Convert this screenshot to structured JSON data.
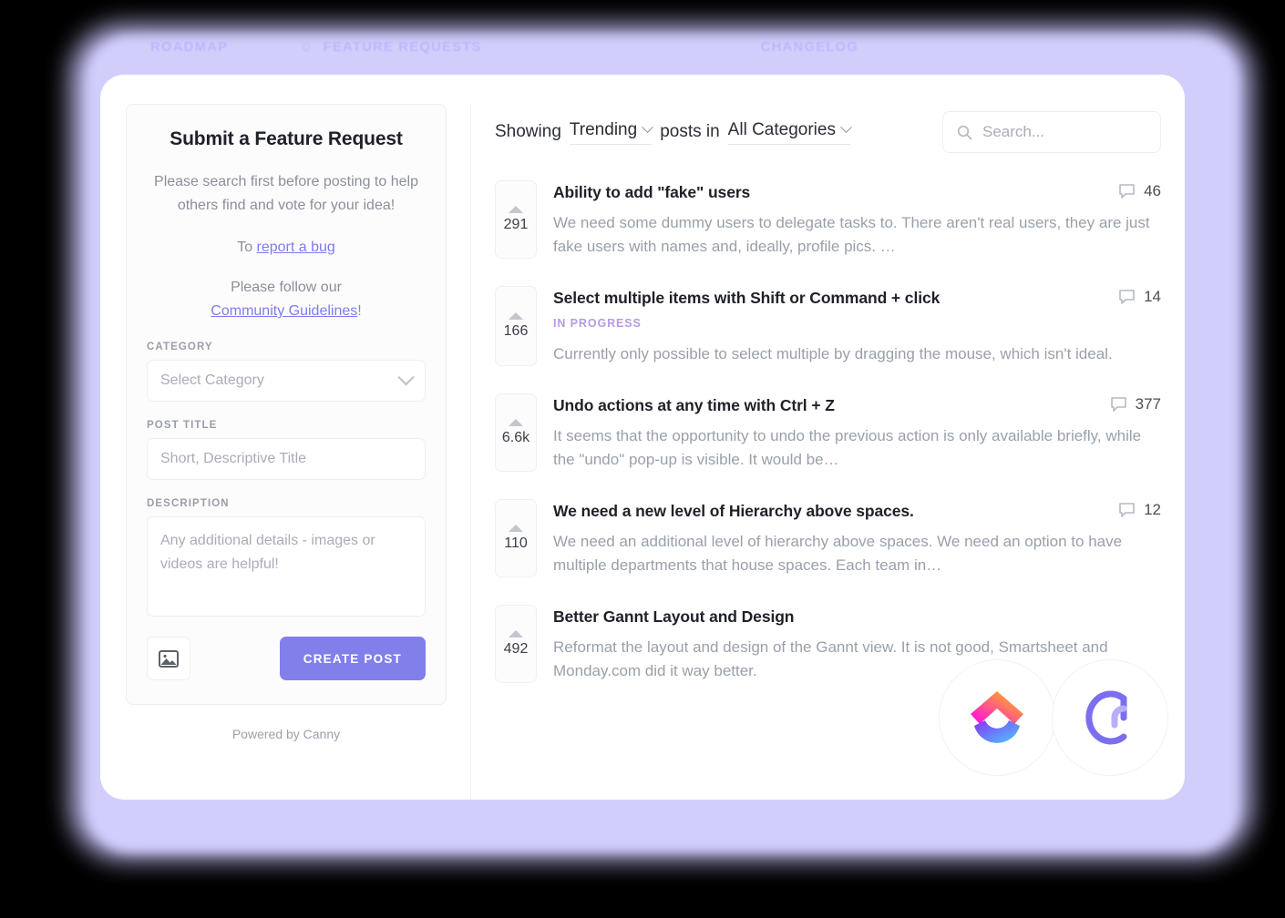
{
  "nav": {
    "items": [
      {
        "label": "ROADMAP"
      },
      {
        "label": "FEATURE REQUESTS"
      },
      {
        "label": "CHANGELOG"
      }
    ]
  },
  "form": {
    "title": "Submit a Feature Request",
    "blurb_1": "Please search first before posting to help others find and vote for your idea!",
    "blurb_2_prefix": "To ",
    "blurb_2_link": "report a bug",
    "blurb_3_prefix": "Please follow our",
    "blurb_3_link": "Community Guidelines",
    "blurb_3_suffix": "!",
    "category_label": "CATEGORY",
    "category_value": "Select Category",
    "post_title_label": "POST TITLE",
    "post_title_placeholder": "Short, Descriptive Title",
    "description_label": "DESCRIPTION",
    "description_placeholder": "Any additional details - images or videos are helpful!",
    "image_button": "image-upload",
    "create_button": "CREATE POST",
    "powered_by": "Powered by Canny"
  },
  "filters": {
    "showing_label": "Showing",
    "sort_value": "Trending",
    "posts_in_label": "posts in",
    "category_value": "All Categories",
    "search_placeholder": "Search..."
  },
  "posts": [
    {
      "votes": "291",
      "title": "Ability to add \"fake\" users",
      "status": "",
      "description": "We need some dummy users to delegate tasks to. There aren't real users, they are just fake users with names and, ideally, profile pics. …",
      "comments": "46"
    },
    {
      "votes": "166",
      "title": "Select multiple items with Shift or Command + click",
      "status": "IN PROGRESS",
      "description": "Currently only possible to select multiple by dragging the mouse, which isn't ideal.",
      "comments": "14"
    },
    {
      "votes": "6.6k",
      "title": "Undo actions at any time with Ctrl + Z",
      "status": "",
      "description": "It seems that the opportunity to undo the previous action is only available briefly, while the \"undo\" pop-up is visible. It would be…",
      "comments": "377"
    },
    {
      "votes": "110",
      "title": "We need a new level of Hierarchy above spaces.",
      "status": "",
      "description": "We need an additional level of hierarchy above spaces. We need an option to have multiple departments that house spaces. Each team in…",
      "comments": "12"
    },
    {
      "votes": "492",
      "title": "Better Gannt Layout and Design",
      "status": "",
      "description": "Reformat the layout and design of the Gannt view. It is not good, Smartsheet and Monday.com did it way better.",
      "comments": ""
    }
  ],
  "brands": [
    {
      "name": "clickup-logo"
    },
    {
      "name": "canny-logo"
    }
  ],
  "colors": {
    "accent": "#817fe9",
    "link": "#7e7cf0",
    "status_in_progress": "#b79ae2",
    "glow": "#c9c5fb"
  }
}
